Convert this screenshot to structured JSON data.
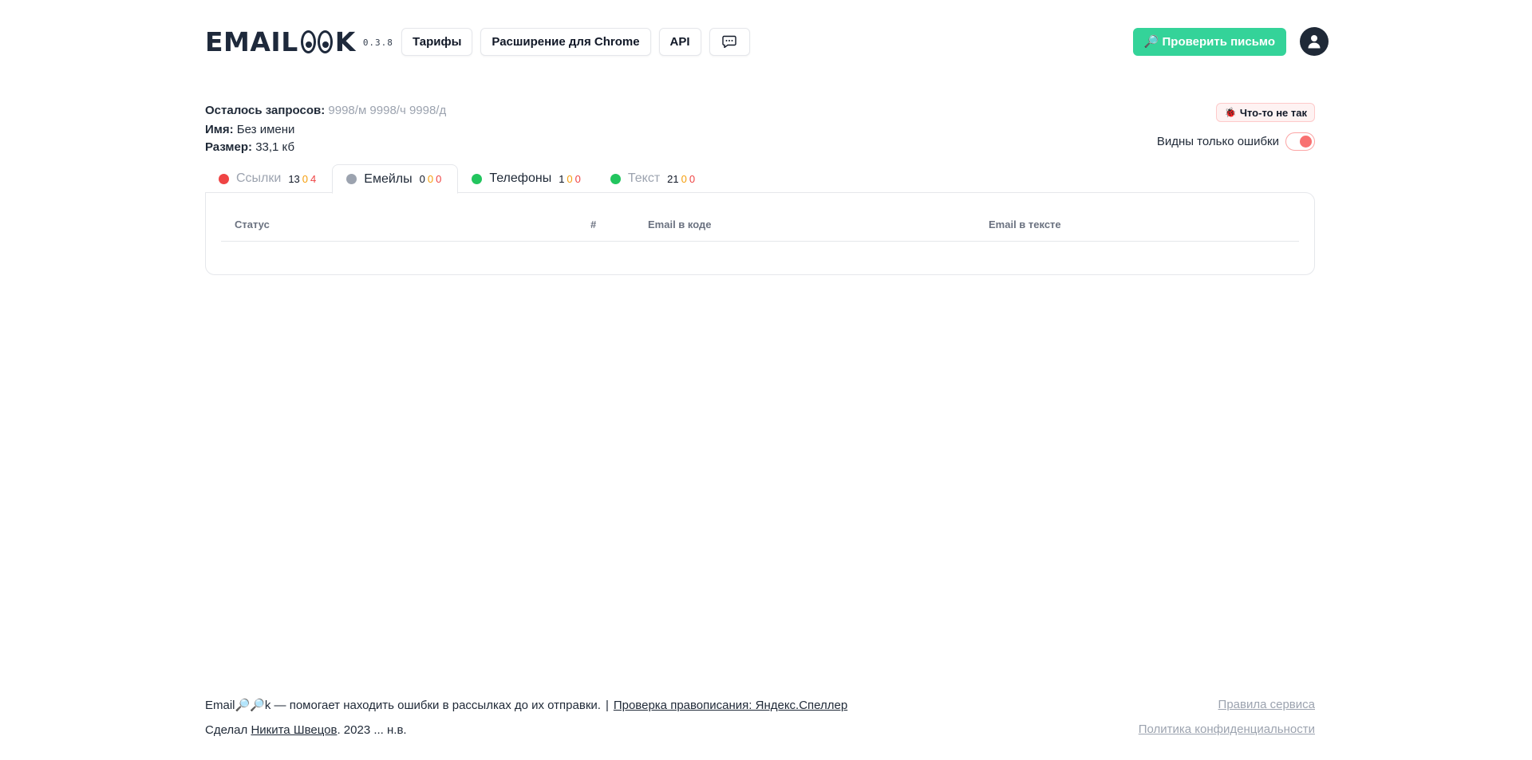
{
  "header": {
    "logo_prefix": "EMAIL",
    "logo_suffix": "K",
    "version": "0.3.8",
    "nav": {
      "tariffs": "Тарифы",
      "chrome_extension": "Расширение для Chrome",
      "api": "API",
      "chat_icon": "chat-bubble-icon"
    },
    "check_button": "Проверить письмо",
    "check_button_icon": "🔎",
    "avatar_icon": "user-icon",
    "accent_color": "#34d399"
  },
  "info": {
    "requests_label": "Осталось запросов:",
    "requests_value": "9998/м 9998/ч 9998/д",
    "name_label": "Имя:",
    "name_value": "Без имени",
    "size_label": "Размер:",
    "size_value": "33,1 кб"
  },
  "report_button": {
    "icon": "🐞",
    "label": "Что-то не так"
  },
  "errors_toggle": {
    "label": "Видны только ошибки",
    "on": true
  },
  "tabs": [
    {
      "label": "Ссылки",
      "dot_color": "#ef4444",
      "ok": "13",
      "warn": "0",
      "err": "4",
      "active": false
    },
    {
      "label": "Емейлы",
      "dot_color": "#9ca3af",
      "ok": "0",
      "warn": "0",
      "err": "0",
      "active": true
    },
    {
      "label": "Телефоны",
      "dot_color": "#22c55e",
      "ok": "1",
      "warn": "0",
      "err": "0",
      "active": false
    },
    {
      "label": "Текст",
      "dot_color": "#22c55e",
      "ok": "21",
      "warn": "0",
      "err": "0",
      "active": false
    }
  ],
  "table": {
    "columns": [
      "Статус",
      "#",
      "Email в коде",
      "Email в тексте"
    ]
  },
  "footer": {
    "brand_prefix": "Email",
    "brand_icons": "🔎🔎",
    "brand_suffix": "k",
    "tagline": " — помогает находить ошибки в рассылках до их отправки.",
    "separator": "|",
    "speller_link": "Проверка правописания: Яндекс.Спеллер",
    "made_by_prefix": "Сделал ",
    "author_link": "Никита Швецов",
    "years": ". 2023 ... н.в.",
    "rules_link": "Правила сервиса",
    "privacy_link": "Политика конфиденциальности"
  }
}
